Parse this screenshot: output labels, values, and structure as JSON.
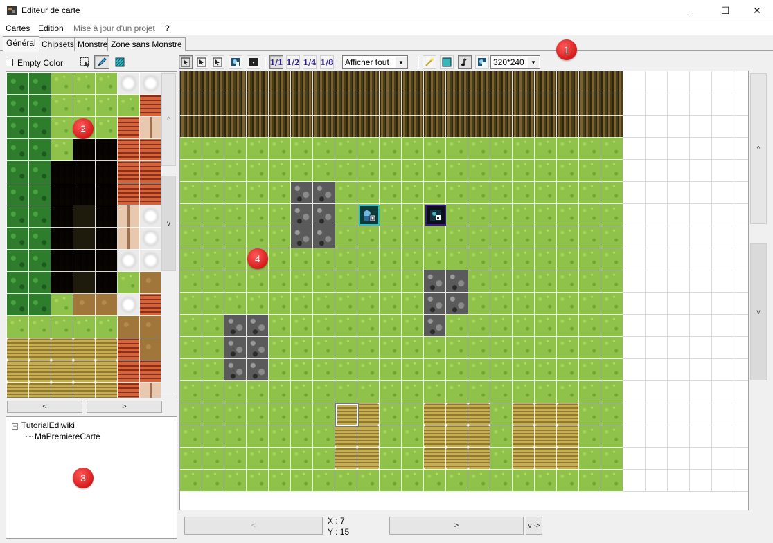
{
  "window": {
    "title": "Editeur de carte",
    "minimize_glyph": "—",
    "maximize_glyph": "☐",
    "close_glyph": "✕"
  },
  "menu": [
    "Cartes",
    "Edition",
    "Mise à jour d'un projet",
    "?"
  ],
  "tabs": [
    "Général",
    "Chipsets",
    "Monstre",
    "Zone sans Monstre"
  ],
  "active_tab": "Général",
  "left_toolbar": {
    "empty_color_label": "Empty Color",
    "empty_color_checked": false
  },
  "chipset_scroll": {
    "up": "^",
    "down": "v",
    "left": "<",
    "right": ">"
  },
  "tree": {
    "expander": "−",
    "root": "TutorialEdiwiki",
    "children": [
      "MaPremiereCarte"
    ]
  },
  "map_toolbar": {
    "zoom_labels": [
      "1/1",
      "1/2",
      "1/4",
      "1/8"
    ],
    "display_select": "Afficher tout",
    "resolution_select": "320*240"
  },
  "map_scroll": {
    "up": "^",
    "down": "v"
  },
  "status": {
    "x_label": "X : 7",
    "y_label": "Y : 15",
    "prev": "<",
    "next": ">",
    "mode_button": "v ->"
  },
  "annotations": [
    "1",
    "2",
    "3",
    "4"
  ],
  "colors": {
    "grass": "#8fc24b",
    "badge": "#d41a1a",
    "event_border_cyan": "#30c0c0",
    "event_border_purple": "#3a1a80"
  }
}
